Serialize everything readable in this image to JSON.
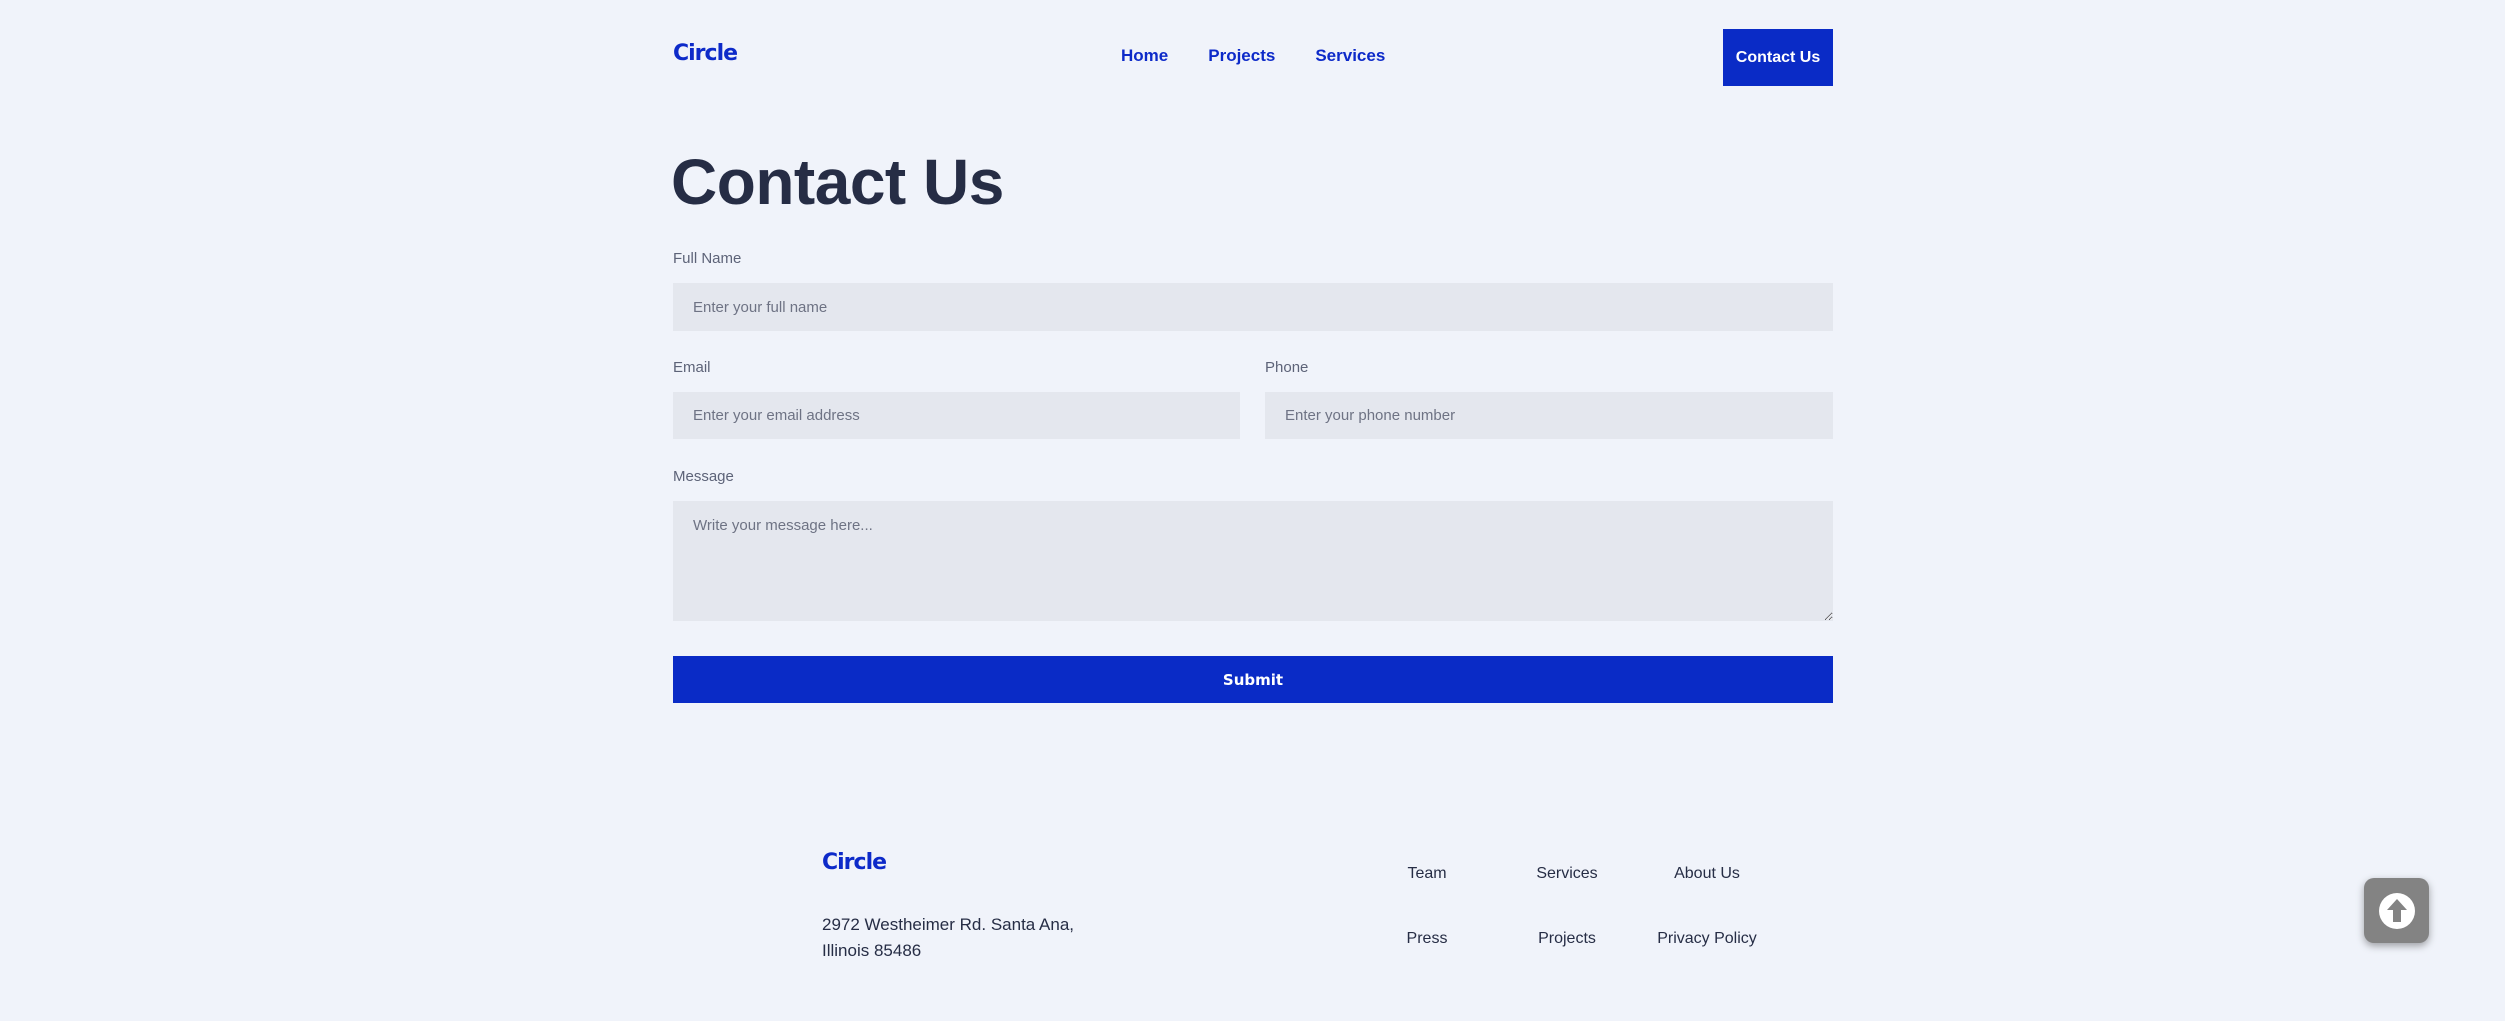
{
  "header": {
    "logo": "Circle",
    "nav": [
      "Home",
      "Projects",
      "Services"
    ],
    "cta": "Contact Us"
  },
  "main": {
    "title": "Contact Us",
    "form": {
      "full_name": {
        "label": "Full Name",
        "placeholder": "Enter your full name"
      },
      "email": {
        "label": "Email",
        "placeholder": "Enter your email address"
      },
      "phone": {
        "label": "Phone",
        "placeholder": "Enter your phone number"
      },
      "message": {
        "label": "Message",
        "placeholder": "Write your message here..."
      },
      "submit": "Submit"
    }
  },
  "footer": {
    "logo": "Circle",
    "address_line1": "2972 Westheimer Rd. Santa Ana,",
    "address_line2": "Illinois 85486",
    "links": [
      "Team",
      "Services",
      "About Us",
      "Press",
      "Projects",
      "Privacy Policy"
    ]
  },
  "scroll_top": {
    "icon": "arrow-up-circle-icon"
  },
  "colors": {
    "brand": "#0a2bc6",
    "background": "#f0f3fa",
    "field": "#e4e7ee",
    "heading": "#262d45"
  }
}
